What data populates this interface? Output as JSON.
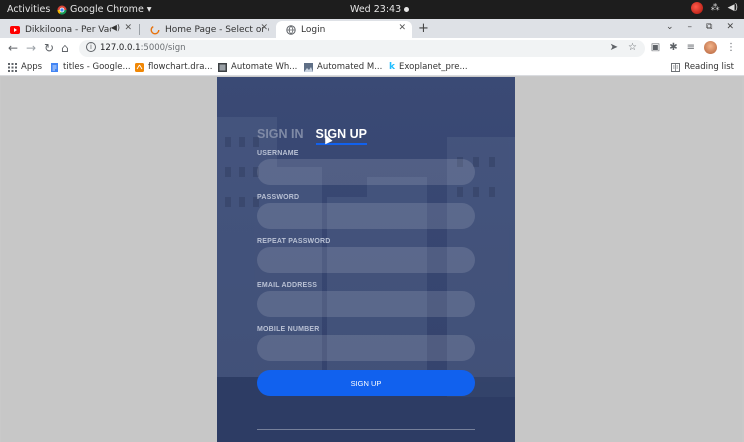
{
  "system_bar": {
    "activities": "Activities",
    "app_name": "Google Chrome",
    "clock": "Wed 23:43"
  },
  "browser": {
    "tabs": [
      {
        "title": "Dikkiloona - Per Vacha",
        "active": false
      },
      {
        "title": "Home Page - Select or cre",
        "active": false
      },
      {
        "title": "Login",
        "active": true
      }
    ],
    "url_host": "127.0.0.1",
    "url_path": ":5000/sign",
    "bookmarks": [
      {
        "label": "Apps"
      },
      {
        "label": "titles - Google..."
      },
      {
        "label": "flowchart.dra..."
      },
      {
        "label": "Automate Wh..."
      },
      {
        "label": "Automated M..."
      },
      {
        "label": "Exoplanet_pre..."
      }
    ],
    "reading_list": "Reading list"
  },
  "form": {
    "tab_signin": "SIGN IN",
    "tab_signup": "SIGN UP",
    "labels": {
      "username": "USERNAME",
      "password": "PASSWORD",
      "repeat_password": "REPEAT PASSWORD",
      "email": "EMAIL ADDRESS",
      "mobile": "MOBILE NUMBER"
    },
    "submit_label": "SIGN UP"
  },
  "colors": {
    "accent": "#1161ee",
    "card_bg": "#2e3f6e",
    "page_bg": "#c7c7c7"
  }
}
